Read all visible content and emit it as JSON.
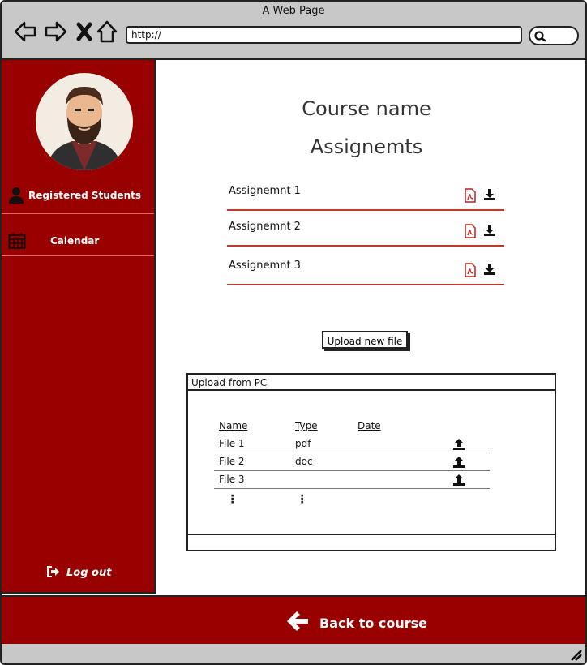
{
  "window": {
    "title": "A Web Page"
  },
  "browser": {
    "url": "http://"
  },
  "sidebar": {
    "items": [
      {
        "label": "Registered Students",
        "icon": "user-icon"
      },
      {
        "label": "Calendar",
        "icon": "calendar-icon"
      }
    ],
    "logout_label": "Log out"
  },
  "main": {
    "course_title": "Course name",
    "section_title": "Assignemts",
    "assignments": [
      {
        "name": "Assignemnt 1"
      },
      {
        "name": "Assignemnt 2"
      },
      {
        "name": "Assignemnt 3"
      }
    ],
    "upload_button_label": "Upload new file"
  },
  "upload_dialog": {
    "title": "Upload from PC",
    "columns": [
      "Name",
      "Type",
      "Date"
    ],
    "files": [
      {
        "name": "File 1",
        "type": "pdf",
        "date": ""
      },
      {
        "name": "File 2",
        "type": "doc",
        "date": ""
      },
      {
        "name": "File 3",
        "type": "",
        "date": ""
      }
    ]
  },
  "footer": {
    "back_label": "Back to course"
  },
  "colors": {
    "accent": "#990000",
    "divider": "#c0392b",
    "chrome": "#c8c8c8"
  }
}
